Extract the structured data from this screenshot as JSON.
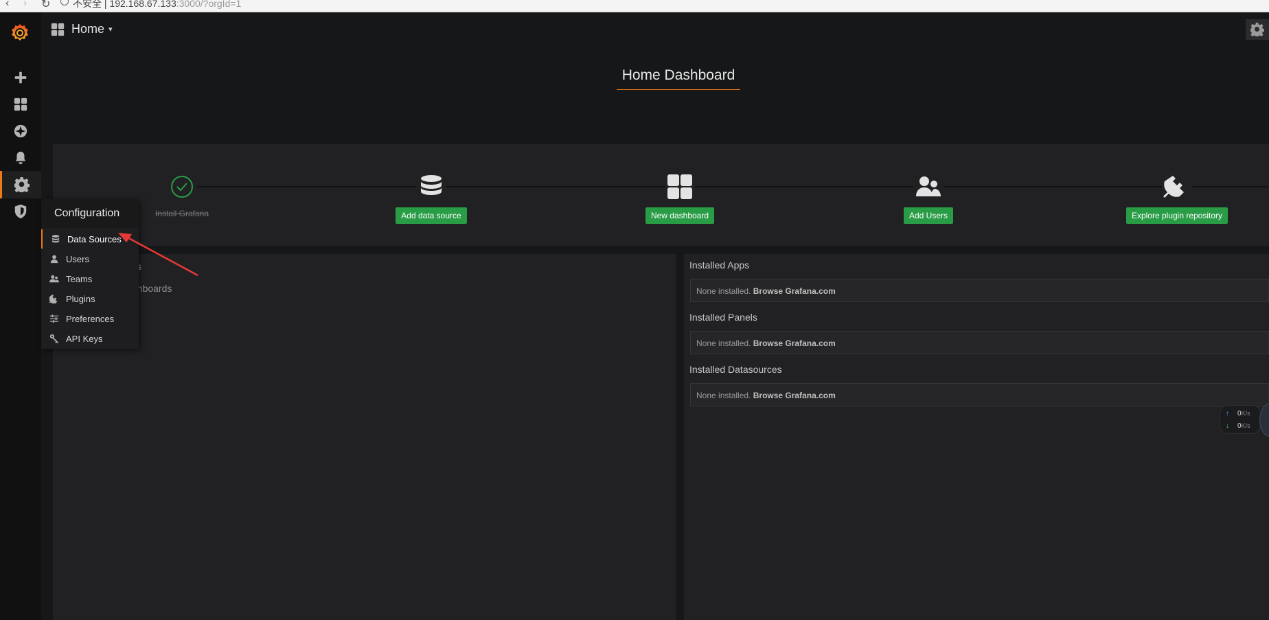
{
  "browser": {
    "nav_back": "‹",
    "nav_forward": "›",
    "nav_reload": "↻",
    "url_prefix": "不安全 | 192.168.67.133",
    "url_rest": ":3000/?orgId=1"
  },
  "topnav": {
    "dashboard_name": "Home",
    "caret": "▾"
  },
  "page_title": "Home Dashboard",
  "steps": [
    {
      "label": "Install Grafana",
      "icon": "check-circle-icon",
      "done": true
    },
    {
      "label": "Add data source",
      "icon": "database-icon",
      "done": false
    },
    {
      "label": "New dashboard",
      "icon": "dashboard-grid-icon",
      "done": false
    },
    {
      "label": "Add Users",
      "icon": "users-icon",
      "done": false
    },
    {
      "label": "Explore plugin repository",
      "icon": "plug-icon",
      "done": false
    }
  ],
  "left_panel": {
    "partial_title": "s",
    "partial_item": "ashboards"
  },
  "installed": {
    "apps_title": "Installed Apps",
    "panels_title": "Installed Panels",
    "datasources_title": "Installed Datasources",
    "none_text": "None installed.",
    "browse_link": "Browse Grafana.com"
  },
  "config_menu": {
    "title": "Configuration",
    "items": [
      {
        "label": "Data Sources",
        "icon": "database-icon",
        "active": true
      },
      {
        "label": "Users",
        "icon": "user-icon",
        "active": false
      },
      {
        "label": "Teams",
        "icon": "users-icon",
        "active": false
      },
      {
        "label": "Plugins",
        "icon": "plug-icon",
        "active": false
      },
      {
        "label": "Preferences",
        "icon": "sliders-icon",
        "active": false
      },
      {
        "label": "API Keys",
        "icon": "key-icon",
        "active": false
      }
    ]
  },
  "net_speed": {
    "up_value": "0",
    "down_value": "0",
    "unit": "K/s",
    "up_arrow": "↑",
    "down_arrow": "↓"
  },
  "colors": {
    "accent": "#eb7b18",
    "button_green": "#299c46",
    "annotation_red": "#e53935"
  }
}
